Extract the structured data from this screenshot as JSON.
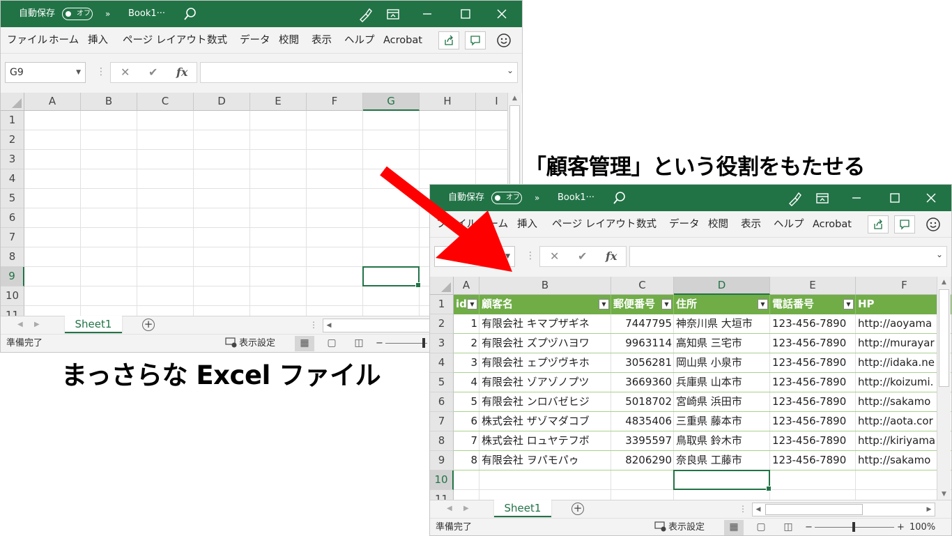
{
  "captions": {
    "top": "「顧客管理」という役割をもたせる",
    "bottom": "まっさらな Excel ファイル"
  },
  "colors": {
    "excel_green": "#217346",
    "table_header": "#70ad47",
    "arrow": "#ff0000"
  },
  "windows": {
    "blank": {
      "title": {
        "autosave": "自動保存",
        "toggle": "オフ",
        "more": "»",
        "book": "Book1···"
      },
      "menu": [
        "ファイル",
        "ホーム",
        "挿入",
        "ページ レイアウト",
        "数式",
        "データ",
        "校閲",
        "表示",
        "ヘルプ",
        "Acrobat"
      ],
      "namebox": "G9",
      "columns": [
        "A",
        "B",
        "C",
        "D",
        "E",
        "F",
        "G",
        "H",
        "I"
      ],
      "selected_column": "G",
      "rows": [
        "1",
        "2",
        "3",
        "4",
        "5",
        "6",
        "7",
        "8",
        "9",
        "10",
        "11"
      ],
      "selected_row": "9",
      "sheet_tab": "Sheet1",
      "status": "準備完了",
      "display_settings": "表示設定"
    },
    "table": {
      "title": {
        "autosave": "自動保存",
        "toggle": "オフ",
        "more": "»",
        "book": "Book1···"
      },
      "menu": [
        "ファイル",
        "ホーム",
        "挿入",
        "ページ レイアウト",
        "数式",
        "データ",
        "校閲",
        "表示",
        "ヘルプ",
        "Acrobat"
      ],
      "columns": [
        "A",
        "B",
        "C",
        "D",
        "E",
        "F"
      ],
      "selected_column": "D",
      "rows": [
        "1",
        "2",
        "3",
        "4",
        "5",
        "6",
        "7",
        "8",
        "9",
        "10",
        "11"
      ],
      "selected_row": "10",
      "headers": [
        "id",
        "顧客名",
        "郵便番号",
        "住所",
        "電話番号",
        "HP"
      ],
      "records": [
        [
          "1",
          "有限会社 キマプザギネ",
          "7447795",
          "神奈川県 大垣市",
          "123-456-7890",
          "http://aoyama"
        ],
        [
          "2",
          "有限会社 ズプヅハヨワ",
          "9963114",
          "高知県 三宅市",
          "123-456-7890",
          "http://murayar"
        ],
        [
          "3",
          "有限会社 ェプヅヴキホ",
          "3056281",
          "岡山県 小泉市",
          "123-456-7890",
          "http://idaka.ne"
        ],
        [
          "4",
          "有限会社 ゾアゾノプツ",
          "3669360",
          "兵庫県 山本市",
          "123-456-7890",
          "http://koizumi."
        ],
        [
          "5",
          "有限会社 ンロバゼヒジ",
          "5018702",
          "宮崎県 浜田市",
          "123-456-7890",
          "http://sakamo"
        ],
        [
          "6",
          "株式会社 ザゾマダコブ",
          "4835406",
          "三重県 藤本市",
          "123-456-7890",
          "http://aota.cor"
        ],
        [
          "7",
          "株式会社 ロュヤテフボ",
          "3395597",
          "鳥取県 鈴木市",
          "123-456-7890",
          "http://kiriyama"
        ],
        [
          "8",
          "有限会社 ヲパモパゥ",
          "8206290",
          "奈良県 工藤市",
          "123-456-7890",
          "http://sakamo"
        ]
      ],
      "sheet_tab": "Sheet1",
      "status": "準備完了",
      "display_settings": "表示設定",
      "zoom": "100%"
    }
  }
}
